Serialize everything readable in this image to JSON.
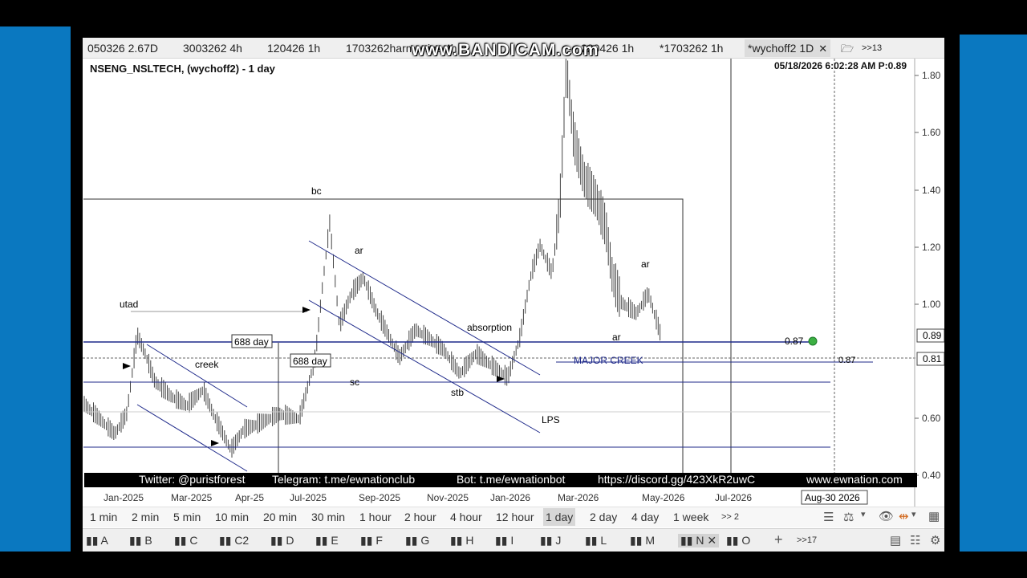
{
  "tabs": [
    {
      "label": "050326 2.67D"
    },
    {
      "label": "3003262 4h"
    },
    {
      "label": "120426 1h"
    },
    {
      "label": "1703262harmonics 4h"
    },
    {
      "label": "220426 1h"
    },
    {
      "label": "*1703262 1h"
    },
    {
      "label": "*wychoff2 1D",
      "active": true
    }
  ],
  "tab_overflow": ">>13",
  "watermark": "www.BANDICAM.com",
  "chart": {
    "title": "NSENG_NSLTECH, (wychoff2) - 1 day",
    "datestamp": "05/18/2026 6:02:28 AM  P:0.89",
    "price_axis": [
      "1.80",
      "1.60",
      "1.40",
      "1.20",
      "1.00",
      "0.60",
      "0.40"
    ],
    "price_tags": [
      "0.89",
      "0.81"
    ],
    "date_axis": [
      "Jan-2025",
      "Mar-2025",
      "Apr-25",
      "Jul-2025",
      "Sep-2025",
      "Nov-2025",
      "Jan-2026",
      "Mar-2026",
      "May-2026",
      "Jul-2026"
    ],
    "cursor_date": "Aug-30 2026",
    "annotations": {
      "utad": "utad",
      "creek": "creek",
      "bc": "bc",
      "ar_left": "ar",
      "sc": "sc",
      "absorption": "absorption",
      "stb": "stb",
      "lps": "LPS",
      "ar_mid": "ar",
      "ar_right": "ar",
      "major_creek": "MAJOR CREEK",
      "day688a": "688 day",
      "day688b": "688 day",
      "level_087": "0.87",
      "cross_087": "0.87"
    }
  },
  "social": {
    "twitter": "Twitter: @puristforest",
    "telegram": "Telegram: t.me/ewnationclub",
    "bot": "Bot: t.me/ewnationbot",
    "discord": "https://discord.gg/423XkR2uwC",
    "site": "www.ewnation.com"
  },
  "timeframes": [
    "1 min",
    "2 min",
    "5 min",
    "10 min",
    "20 min",
    "30 min",
    "1 hour",
    "2 hour",
    "4 hour",
    "12 hour",
    "1 day",
    "2 day",
    "4 day",
    "1 week",
    ">> 2"
  ],
  "active_timeframe": "1 day",
  "sheets": [
    "A",
    "B",
    "C",
    "C2",
    "D",
    "E",
    "F",
    "G",
    "H",
    "I",
    "J",
    "L",
    "M",
    "N",
    "O"
  ],
  "active_sheet": "N",
  "sheet_overflow": ">>17",
  "colors": {
    "channel": "#1f2a8a",
    "accent_blue": "#0a78c0",
    "green_dot": "#3cb043"
  }
}
